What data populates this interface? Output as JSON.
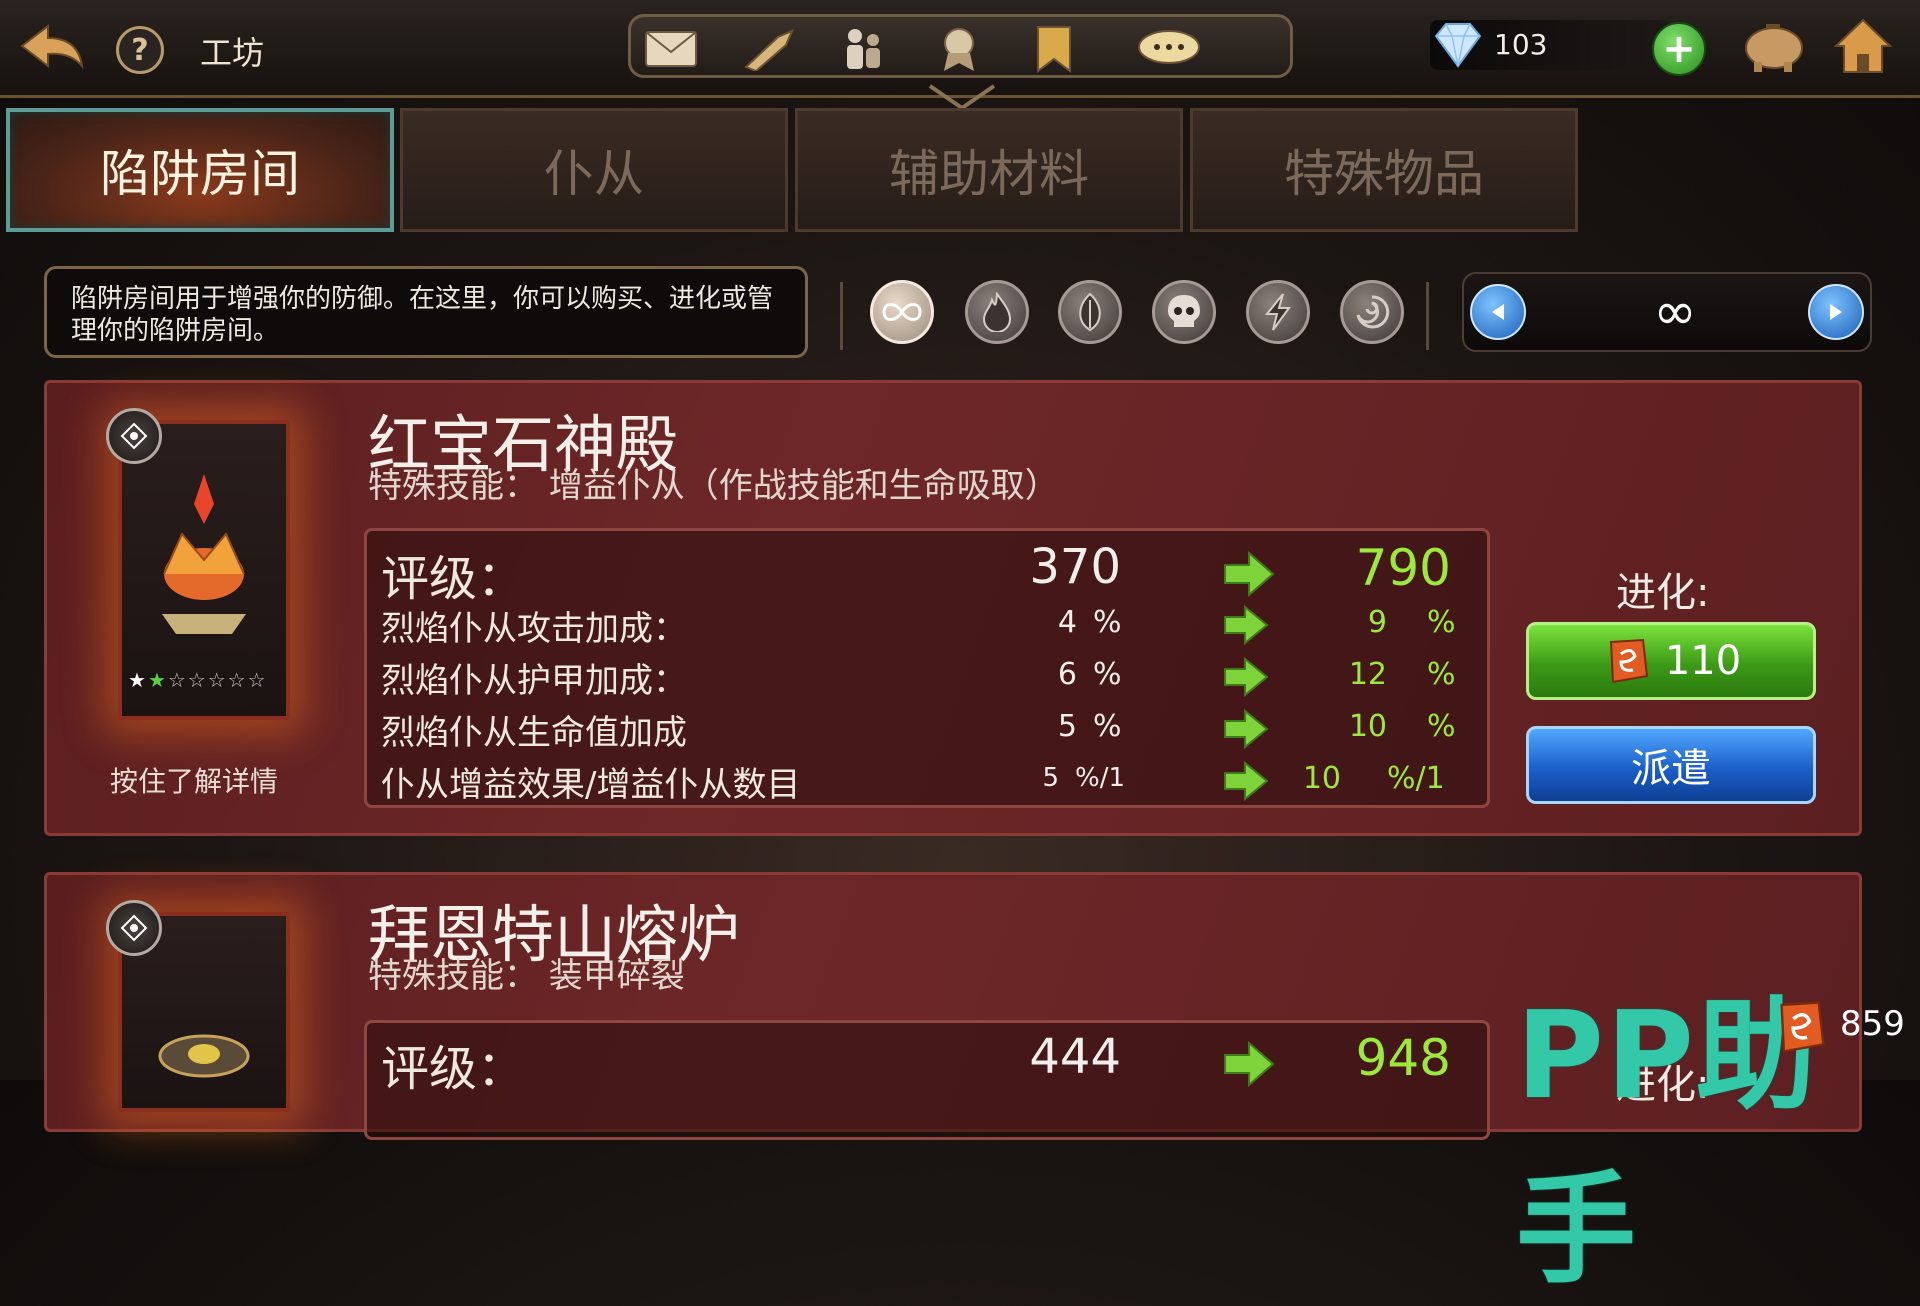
{
  "header": {
    "title": "工坊",
    "gem_count": "103"
  },
  "tabs": [
    {
      "label": "陷阱房间",
      "active": true
    },
    {
      "label": "仆从",
      "active": false
    },
    {
      "label": "辅助材料",
      "active": false
    },
    {
      "label": "特殊物品",
      "active": false
    }
  ],
  "description": "陷阱房间用于增强你的防御。在这里，你可以购买、进化或管理你的陷阱房间。",
  "filters": [
    "infinity",
    "fire",
    "nature",
    "skull",
    "lightning",
    "vortex"
  ],
  "filter_nav": {
    "current_glyph": "∞"
  },
  "rooms": [
    {
      "name": "红宝石神殿",
      "skill": "特殊技能：  增益仆从（作战技能和生命吸取）",
      "stars": "★★☆☆☆☆☆",
      "hold_hint": "按住了解详情",
      "stats": [
        {
          "label": "评级：",
          "cur": "370",
          "cur_unit": "",
          "next": "790",
          "next_unit": ""
        },
        {
          "label": "烈焰仆从攻击加成：",
          "cur": "4",
          "cur_unit": "%",
          "next": "9",
          "next_unit": "%"
        },
        {
          "label": "烈焰仆从护甲加成：",
          "cur": "6",
          "cur_unit": "%",
          "next": "12",
          "next_unit": "%"
        },
        {
          "label": "烈焰仆从生命值加成",
          "cur": "5",
          "cur_unit": "%",
          "next": "10",
          "next_unit": "%"
        },
        {
          "label": "仆从增益效果/增益仆从数目",
          "cur": "5",
          "cur_unit": "%/1",
          "next": "10",
          "next_unit": "%/1"
        }
      ],
      "evolve_label": "进化:",
      "evolve_cost": "110",
      "send_label": "派遣"
    },
    {
      "name": "拜恩特山熔炉",
      "skill": "特殊技能：  装甲碎裂",
      "stats": [
        {
          "label": "评级：",
          "cur": "444",
          "next": "948"
        }
      ],
      "evolve_label": "进化:"
    }
  ],
  "watermark": "PP助手",
  "coin_count": "859"
}
